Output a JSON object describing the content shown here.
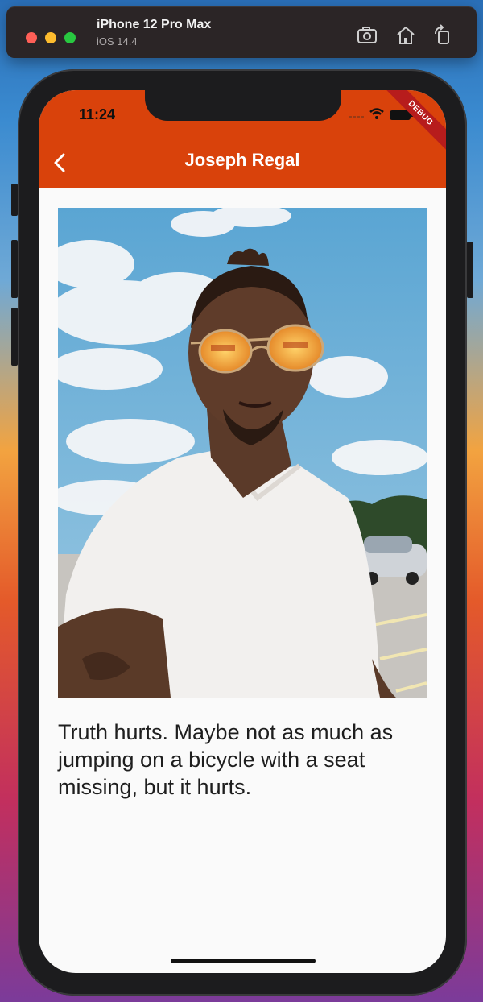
{
  "simulator": {
    "device_name": "iPhone 12 Pro Max",
    "os_version": "iOS 14.4",
    "toolbar": [
      "screenshot-icon",
      "home-icon",
      "rotate-icon"
    ]
  },
  "status_bar": {
    "time": "11:24",
    "debug_label": "DEBUG"
  },
  "app_bar": {
    "title": "Joseph Regal",
    "back_icon": "chevron-left-icon",
    "background_color": "#d9420b"
  },
  "content": {
    "photo_alt": "selfie-photo",
    "quote": "Truth hurts. Maybe not as much as jumping on a bicycle with a seat missing, but it hurts."
  }
}
